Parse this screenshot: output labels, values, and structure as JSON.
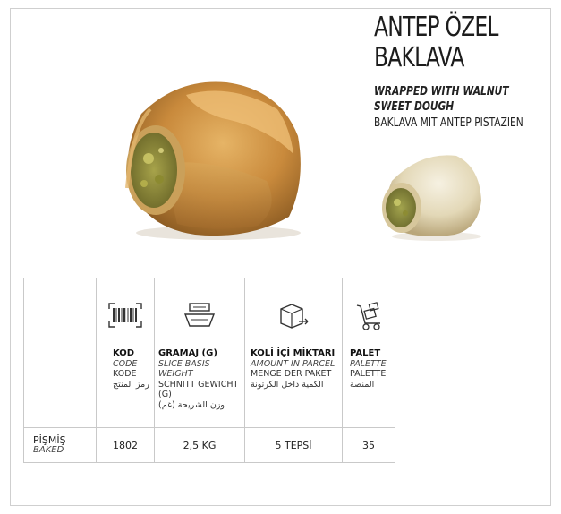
{
  "product": {
    "title_line1": "ANTEP ÖZEL",
    "title_line2": "BAKLAVA",
    "sub_en_1": "WRAPPED WITH WALNUT",
    "sub_en_2": "SWEET DOUGH",
    "sub_de": "BAKLAVA MIT ANTEP PISTAZIEN"
  },
  "table": {
    "columns": [
      {
        "icon": "barcode-icon",
        "label": "KOD",
        "en": "CODE",
        "de": "KODE",
        "ar": "رمز المنتج"
      },
      {
        "icon": "scale-icon",
        "label": "GRAMAJ (G)",
        "en": "SLICE BASIS WEIGHT",
        "de": "SCHNITT GEWICHT (G)",
        "ar": "وزن الشريحة (غم)"
      },
      {
        "icon": "box-icon",
        "label": "KOLİ İÇİ MİKTARI",
        "en": "AMOUNT IN PARCEL",
        "de": "MENGE DER PAKET",
        "ar": "الكمية داخل الكرتونة"
      },
      {
        "icon": "hand-truck-icon",
        "label": "PALET",
        "en": "PALETTE",
        "de": "PALETTE",
        "ar": "المنصة"
      }
    ],
    "row": {
      "label": "PİŞMİŞ",
      "label_en": "BAKED",
      "values": [
        "1802",
        "2,5 KG",
        "5 TEPSİ",
        "35"
      ]
    }
  }
}
